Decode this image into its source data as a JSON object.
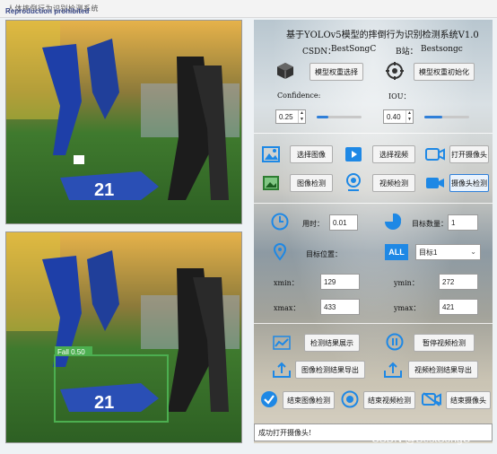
{
  "window": {
    "title_text": "人体摔倒行为识别检测系统",
    "title_overlay": "Reproduction prohibited"
  },
  "detection_box": {
    "label": "Fall 0.50",
    "color": "#4caf50"
  },
  "header": {
    "title": "基于YOLOv5模型的摔倒行为识别检测系统V1.0",
    "csdn_label": "CSDN：",
    "csdn_value": "BestSongC",
    "bili_label": "B站：",
    "bili_value": "Bestsongc"
  },
  "model": {
    "select_button": "模型权重选择",
    "init_button": "模型权重初始化"
  },
  "params": {
    "confidence_label": "Confidence:",
    "confidence_value": "0.25",
    "confidence_level": 0.25,
    "iou_label": "IOU：",
    "iou_value": "0.40",
    "iou_level": 0.4
  },
  "actions": {
    "select_image": "选择图像",
    "select_video": "选择视频",
    "open_camera": "打开摄像头",
    "image_detect": "图像检测",
    "video_detect": "视频检测",
    "camera_detect": "摄像头检测"
  },
  "results": {
    "time_label": "用时：",
    "time_value": "0.01",
    "count_label": "目标数量：",
    "count_value": "1",
    "position_label": "目标位置：",
    "target_selected": "目标1",
    "xmin_label": "xmin：",
    "xmin_value": "129",
    "ymin_label": "ymin：",
    "ymin_value": "272",
    "xmax_label": "xmax：",
    "xmax_value": "433",
    "ymax_label": "ymax：",
    "ymax_value": "421"
  },
  "bottom_actions": {
    "show_results": "检测结果展示",
    "pause_video": "暂停视频检测",
    "export_image": "图像检测结果导出",
    "export_video": "视频检测结果导出",
    "end_image": "结束图像检测",
    "end_video": "结束视频检测",
    "end_camera": "结束摄像头"
  },
  "status": {
    "message": "成功打开摄像头!"
  },
  "watermark": {
    "text": "CSDN @BestSongC"
  },
  "colors": {
    "accent": "#2f7fd8",
    "icon_blue": "#1e88e5",
    "box_green": "#4caf50"
  }
}
